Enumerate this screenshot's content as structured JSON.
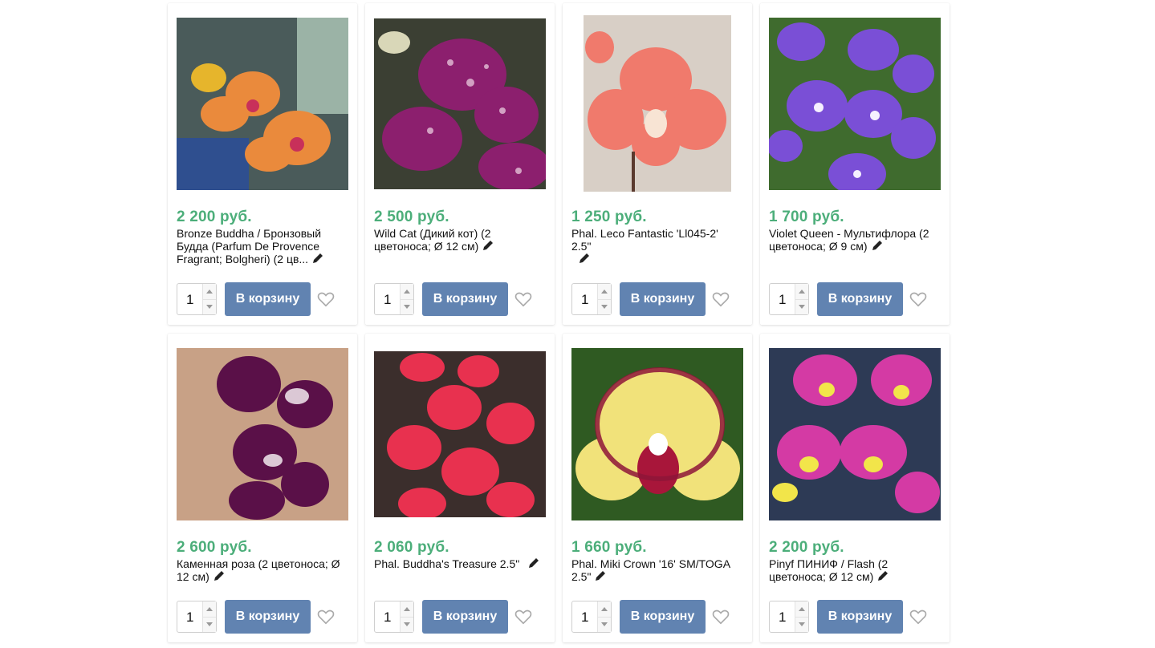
{
  "colors": {
    "price": "#4cae7a",
    "button": "#6183b1"
  },
  "icons": {
    "edit": "pencil-icon",
    "favorite": "heart-icon",
    "spin_up": "caret-up-icon",
    "spin_down": "caret-down-icon"
  },
  "products": [
    {
      "price": "2 200 руб.",
      "name": "Bronze Buddha / Бронзовый Будда (Parfum De Provence Fragrant; Bolgheri) (2 цв...",
      "qty": "1",
      "button": "В корзину"
    },
    {
      "price": "2 500 руб.",
      "name": "Wild Cat (Дикий кот) (2 цветоноса; Ø 12 см)",
      "qty": "1",
      "button": "В корзину"
    },
    {
      "price": "1 250 руб.",
      "name": "Phal. Leco Fantastic 'Ll045-2' 2.5\"",
      "qty": "1",
      "button": "В корзину"
    },
    {
      "price": "1 700 руб.",
      "name": "Violet Queen - Мультифлора (2 цветоноса; Ø 9 см)",
      "qty": "1",
      "button": "В корзину"
    },
    {
      "price": "2 600 руб.",
      "name": "Каменная роза (2 цветоноса; Ø 12 см)",
      "qty": "1",
      "button": "В корзину"
    },
    {
      "price": "2 060 руб.",
      "name": "Phal. Buddha's Treasure 2.5\"",
      "qty": "1",
      "button": "В корзину"
    },
    {
      "price": "1 660 руб.",
      "name": "Phal. Miki Crown '16' SM/TOGA 2.5\"",
      "qty": "1",
      "button": "В корзину"
    },
    {
      "price": "2 200 руб.",
      "name": "Pinyf ПИНИФ / Flash (2 цветоноса; Ø 12 см)",
      "qty": "1",
      "button": "В корзину"
    }
  ]
}
